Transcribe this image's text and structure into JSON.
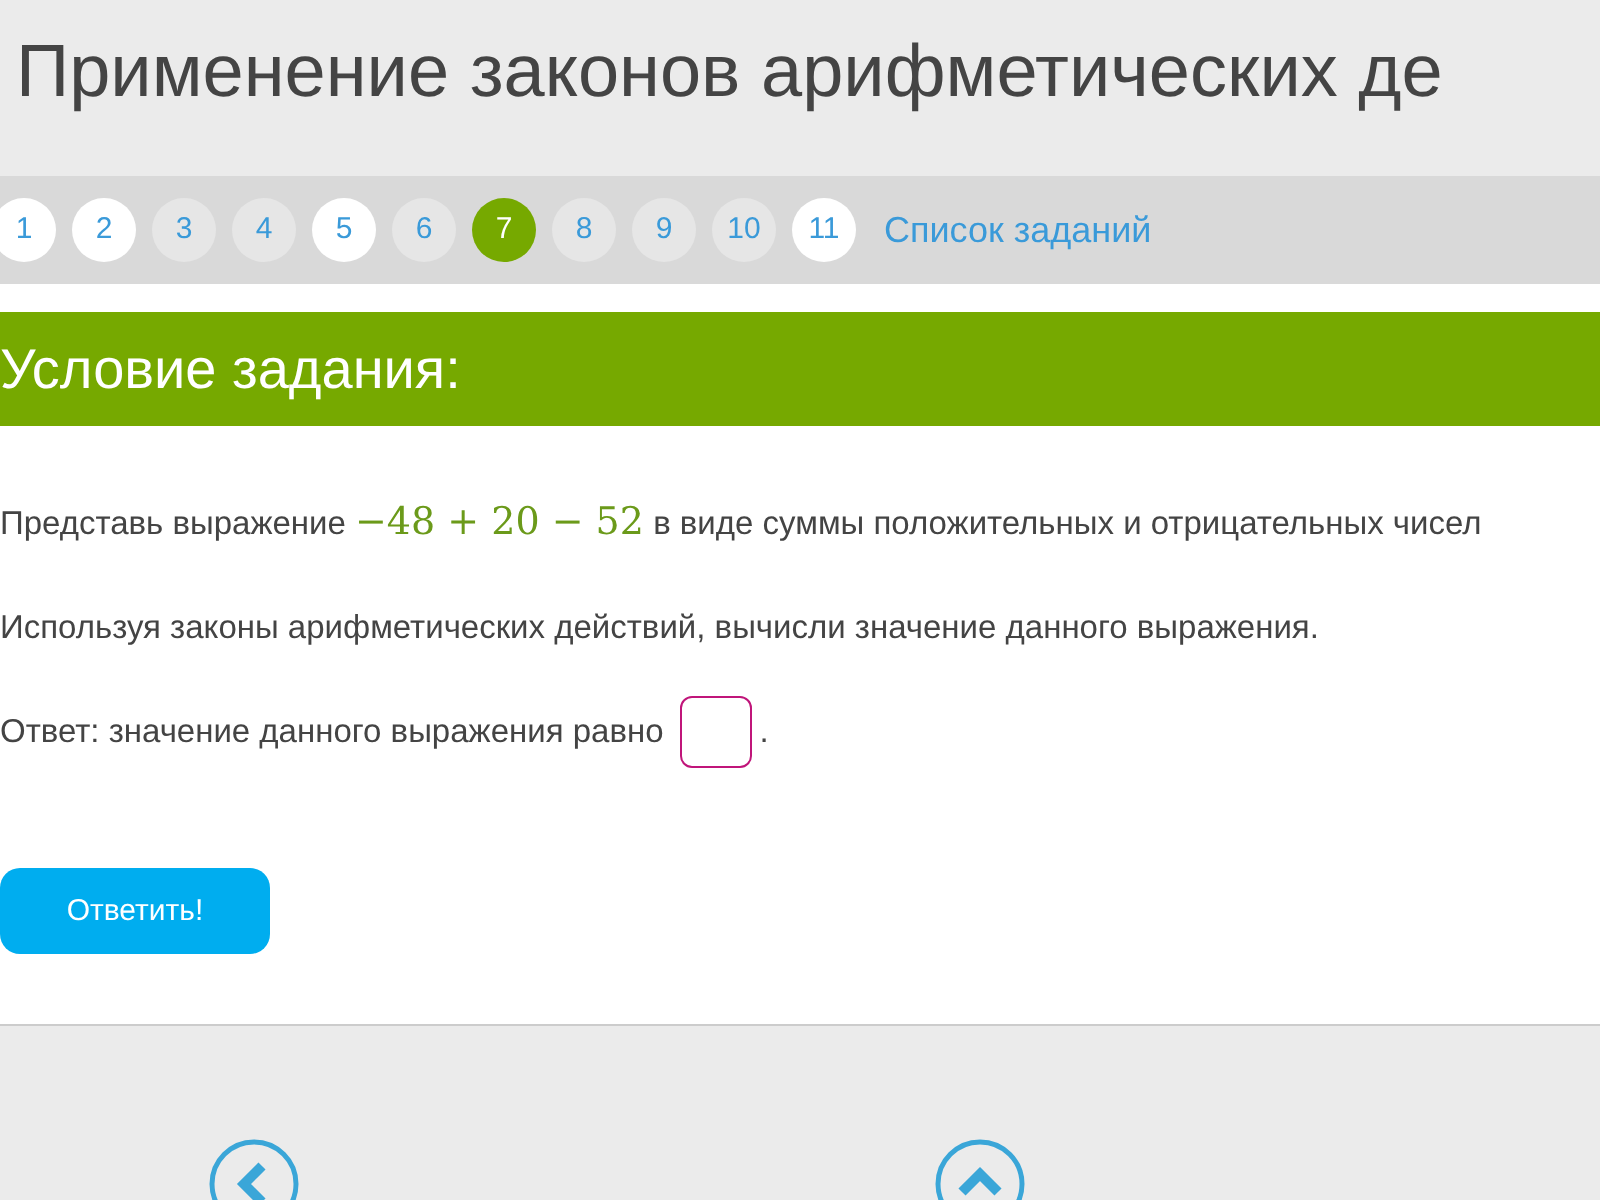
{
  "title": "Применение законов арифметических де",
  "task_nav": {
    "tasks": [
      {
        "label": "1",
        "visited": true,
        "selected": false
      },
      {
        "label": "2",
        "visited": true,
        "selected": false
      },
      {
        "label": "3",
        "visited": false,
        "selected": false
      },
      {
        "label": "4",
        "visited": false,
        "selected": false
      },
      {
        "label": "5",
        "visited": true,
        "selected": false
      },
      {
        "label": "6",
        "visited": false,
        "selected": false
      },
      {
        "label": "7",
        "visited": false,
        "selected": true
      },
      {
        "label": "8",
        "visited": false,
        "selected": false
      },
      {
        "label": "9",
        "visited": false,
        "selected": false
      },
      {
        "label": "10",
        "visited": false,
        "selected": false
      },
      {
        "label": "11",
        "visited": true,
        "selected": false
      }
    ],
    "list_link": "Список заданий"
  },
  "condition_header": "Условие задания:",
  "task": {
    "line_1": {
      "before": "Представь выражение",
      "math": "−48 + 20 − 52",
      "after": "в виде суммы положительных и отрицательных чисел"
    },
    "line_2": "Используя законы арифметических действий, вычисли значение данного выражения.",
    "answer_label": "Ответ: значение данного выражения равно",
    "answer_end": "."
  },
  "submit_button": "Ответить!"
}
